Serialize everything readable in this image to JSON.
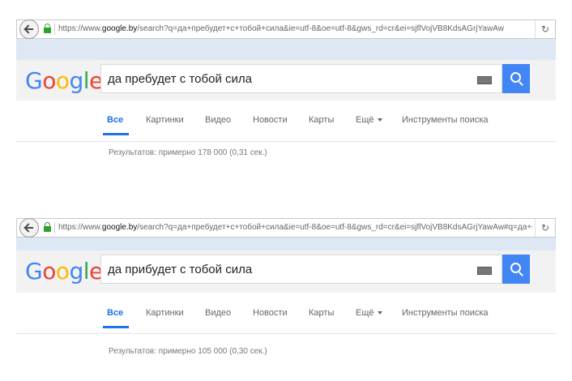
{
  "screenshots": [
    {
      "url_prefix": "https://www.",
      "url_domain": "google.by",
      "url_rest": "/search?q=да+пребудет+с+тобой+сила&ie=utf-8&oe=utf-8&gws_rd=cr&ei=sjflVojVB8KdsAGrjYawAw",
      "query": "да пребудет с тобой сила",
      "results": "Результатов: примерно 178 000 (0,31 сек.)"
    },
    {
      "url_prefix": "https://www.",
      "url_domain": "google.by",
      "url_rest": "/search?q=да+пребудет+с+тобой+сила&ie=utf-8&oe=utf-8&gws_rd=cr&ei=sjflVojVB8KdsAGrjYawAw#q=да+пр",
      "query": "да прибудет с тобой сила",
      "results": "Результатов: примерно 105 000 (0,30 сек.)"
    }
  ],
  "logo": {
    "text": "Google"
  },
  "tabs": [
    "Все",
    "Картинки",
    "Видео",
    "Новости",
    "Карты",
    "Ещё",
    "Инструменты поиска"
  ],
  "icons": {
    "back": "back-arrow-icon",
    "lock": "lock-icon",
    "reload": "reload-icon",
    "keyboard": "keyboard-icon",
    "search": "search-icon"
  },
  "colors": {
    "accent": "#4285f4",
    "active_tab": "#1a73e8",
    "header_bg": "#f2f2f2",
    "strip_bg": "#dee8f5"
  }
}
